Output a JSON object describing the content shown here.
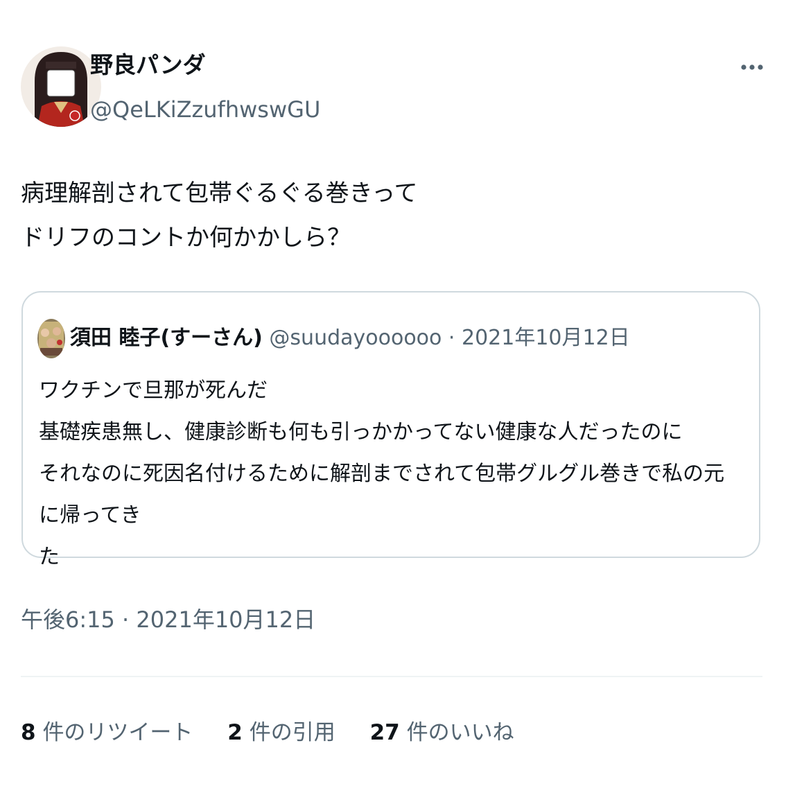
{
  "author": {
    "display_name": "野良パンダ",
    "handle": "@QeLKiZzufhwswGU",
    "avatar_icon": "user-avatar-icon"
  },
  "more_icon": "more-options-icon",
  "tweet": {
    "text": "病理解剖されて包帯ぐるぐる巻きって\nドリフのコントか何かかしら？"
  },
  "quote": {
    "author_name": "須田 睦子(すーさん)",
    "handle": "@suudayoooooo",
    "separator": " · ",
    "date": "2021年10月12日",
    "avatar_icon": "quoted-user-avatar-icon",
    "text": "ワクチンで旦那が死んだ\n基礎疾患無し、健康診断も何も引っかかってない健康な人だったのに\nそれなのに死因名付けるために解剖までされて包帯グルグル巻きで私の元に帰ってき\nた"
  },
  "timestamp": "午後6:15 · 2021年10月12日",
  "stats": {
    "retweets": {
      "count": "8",
      "label": "件のリツイート"
    },
    "quotes": {
      "count": "2",
      "label": "件の引用"
    },
    "likes": {
      "count": "27",
      "label": "件のいいね"
    }
  },
  "colors": {
    "text_primary": "#0f1419",
    "text_secondary": "#536471",
    "border": "#cfd9de",
    "divider": "#eff3f4"
  }
}
